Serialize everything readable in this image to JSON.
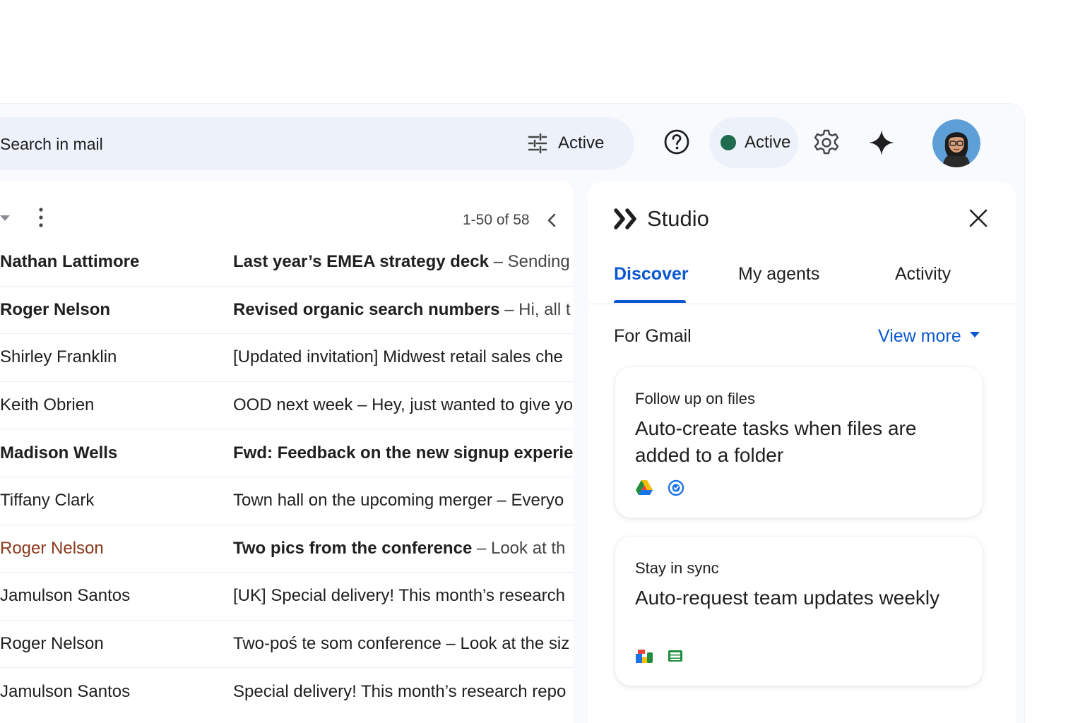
{
  "search": {
    "placeholder": "Search in mail"
  },
  "header": {
    "filter_label": "Active",
    "status_label": "Active",
    "status_color": "#1e6b4e"
  },
  "toolbar": {
    "pager": "1-50 of 58"
  },
  "mail": {
    "rows": [
      {
        "sender": "Nathan Lattimore",
        "subject": "Last year’s EMEA strategy deck",
        "snippet": " – Sending",
        "unread": true
      },
      {
        "sender": "Roger Nelson",
        "subject": "Revised organic search numbers",
        "snippet": " – Hi, all t",
        "unread": true
      },
      {
        "sender": "Shirley Franklin",
        "subject": "[Updated invitation] Midwest retail sales che",
        "snippet": "",
        "unread": false
      },
      {
        "sender": "Keith Obrien",
        "subject": "OOD next week – Hey, just wanted to give yo",
        "snippet": "",
        "unread": false
      },
      {
        "sender": "Madison Wells",
        "subject": "Fwd: Feedback on the new signup experie",
        "snippet": "",
        "unread": true
      },
      {
        "sender": "Tiffany Clark",
        "subject": "Town hall on the upcoming merger – Everyo",
        "snippet": "",
        "unread": false
      },
      {
        "sender": "Roger Nelson",
        "subject": "Two pics from the conference",
        "snippet": " – Look at th",
        "unread": true,
        "accent": true
      },
      {
        "sender": "Jamulson Santos",
        "subject": "[UK] Special delivery! This month’s research",
        "snippet": "",
        "unread": false
      },
      {
        "sender": "Roger Nelson",
        "subject": "Two-poś te som conference – Look at the siz",
        "snippet": "",
        "unread": false
      },
      {
        "sender": "Jamulson Santos",
        "subject": "Special delivery! This month’s research repo",
        "snippet": "",
        "unread": false
      }
    ]
  },
  "studio": {
    "title": "Studio",
    "tabs": [
      {
        "label": "Discover",
        "active": true
      },
      {
        "label": "My agents",
        "active": false
      },
      {
        "label": "Activity",
        "active": false
      }
    ],
    "section_label": "For Gmail",
    "view_more": "View more",
    "cards": [
      {
        "kicker": "Follow up on files",
        "title": "Auto-create tasks when files are added to a folder",
        "icons": [
          "drive-icon",
          "tasks-icon"
        ]
      },
      {
        "kicker": "Stay in sync",
        "title": "Auto-request team updates weekly",
        "icons": [
          "chat-icon",
          "sheets-icon"
        ]
      }
    ]
  },
  "colors": {
    "accent": "#0b57d0",
    "sender_accent": "#8a3a1d",
    "surface": "#f8fafd",
    "search_bg": "#edf2fa"
  }
}
